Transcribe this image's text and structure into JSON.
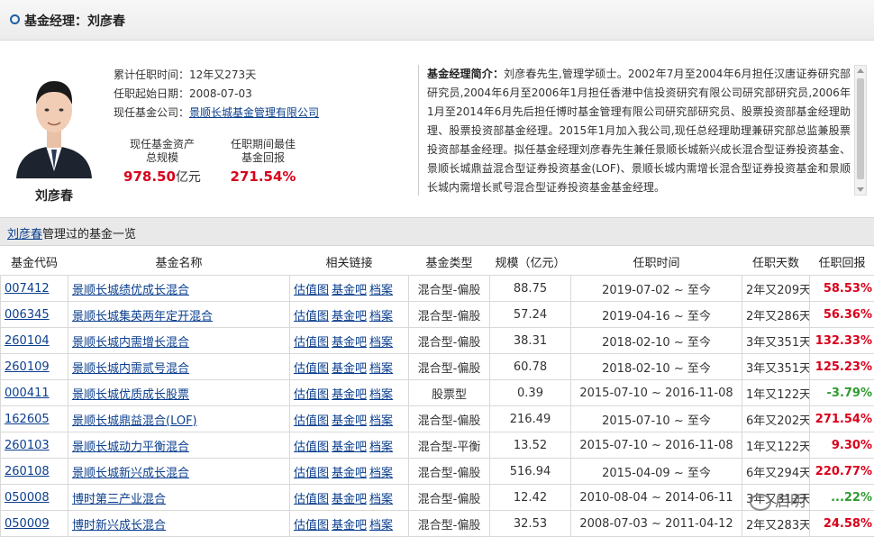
{
  "header": {
    "title": "基金经理：刘彦春"
  },
  "manager": {
    "name": "刘彦春",
    "tenure_label": "累计任职时间：",
    "tenure_value": "12年又273天",
    "start_label": "任职起始日期：",
    "start_value": "2008-07-03",
    "company_label": "现任基金公司：",
    "company_value": "景顺长城基金管理有限公司",
    "aum_label_1": "现任基金资产",
    "aum_label_2": "总规模",
    "aum_value": "978.50",
    "aum_unit": "亿元",
    "best_label_1": "任职期间最佳",
    "best_label_2": "基金回报",
    "best_value": "271.54%"
  },
  "intro": {
    "label": "基金经理简介：",
    "text": "刘彦春先生,管理学硕士。2002年7月至2004年6月担任汉唐证券研究部研究员,2004年6月至2006年1月担任香港中信投资研究有限公司研究部研究员,2006年1月至2014年6月先后担任博时基金管理有限公司研究部研究员、股票投资部基金经理助理、股票投资部基金经理。2015年1月加入我公司,现任总经理助理兼研究部总监兼股票投资部基金经理。拟任基金经理刘彦春先生兼任景顺长城新兴成长混合型证券投资基金、景顺长城鼎益混合型证券投资基金(LOF)、景顺长城内需增长混合型证券投资基金和景顺长城内需增长贰号混合型证券投资基金基金经理。"
  },
  "section": {
    "name_link": "刘彦春",
    "suffix": "管理过的基金一览"
  },
  "table": {
    "headers": [
      "基金代码",
      "基金名称",
      "相关链接",
      "基金类型",
      "规模（亿元）",
      "任职时间",
      "任职天数",
      "任职回报"
    ],
    "link_labels": [
      "估值图",
      "基金吧",
      "档案"
    ],
    "rows": [
      {
        "code": "007412",
        "name": "景顺长城绩优成长混合",
        "type": "混合型-偏股",
        "size": "88.75",
        "period": "2019-07-02 ~ 至今",
        "days": "2年又209天",
        "ret": "58.53%",
        "sign": "pos"
      },
      {
        "code": "006345",
        "name": "景顺长城集英两年定开混合",
        "type": "混合型-偏股",
        "size": "57.24",
        "period": "2019-04-16 ~ 至今",
        "days": "2年又286天",
        "ret": "56.36%",
        "sign": "pos"
      },
      {
        "code": "260104",
        "name": "景顺长城内需增长混合",
        "type": "混合型-偏股",
        "size": "38.31",
        "period": "2018-02-10 ~ 至今",
        "days": "3年又351天",
        "ret": "132.33%",
        "sign": "pos"
      },
      {
        "code": "260109",
        "name": "景顺长城内需贰号混合",
        "type": "混合型-偏股",
        "size": "60.78",
        "period": "2018-02-10 ~ 至今",
        "days": "3年又351天",
        "ret": "125.23%",
        "sign": "pos"
      },
      {
        "code": "000411",
        "name": "景顺长城优质成长股票",
        "type": "股票型",
        "size": "0.39",
        "period": "2015-07-10 ~ 2016-11-08",
        "days": "1年又122天",
        "ret": "-3.79%",
        "sign": "neg"
      },
      {
        "code": "162605",
        "name": "景顺长城鼎益混合(LOF)",
        "type": "混合型-偏股",
        "size": "216.49",
        "period": "2015-07-10 ~ 至今",
        "days": "6年又202天",
        "ret": "271.54%",
        "sign": "pos"
      },
      {
        "code": "260103",
        "name": "景顺长城动力平衡混合",
        "type": "混合型-平衡",
        "size": "13.52",
        "period": "2015-07-10 ~ 2016-11-08",
        "days": "1年又122天",
        "ret": "9.30%",
        "sign": "pos"
      },
      {
        "code": "260108",
        "name": "景顺长城新兴成长混合",
        "type": "混合型-偏股",
        "size": "516.94",
        "period": "2015-04-09 ~ 至今",
        "days": "6年又294天",
        "ret": "220.77%",
        "sign": "pos"
      },
      {
        "code": "050008",
        "name": "博时第三产业混合",
        "type": "混合型-偏股",
        "size": "12.42",
        "period": "2010-08-04 ~ 2014-06-11",
        "days": "3年又312天",
        "ret": "...22%",
        "sign": "neg"
      },
      {
        "code": "050009",
        "name": "博时新兴成长混合",
        "type": "混合型-偏股",
        "size": "32.53",
        "period": "2008-07-03 ~ 2011-04-12",
        "days": "2年又283天",
        "ret": "24.58%",
        "sign": "pos"
      }
    ]
  },
  "watermark": {
    "text": "启明"
  },
  "colors": {
    "positive": "#d9001b",
    "negative": "#2f9b2f",
    "link": "#0b3f8e"
  }
}
